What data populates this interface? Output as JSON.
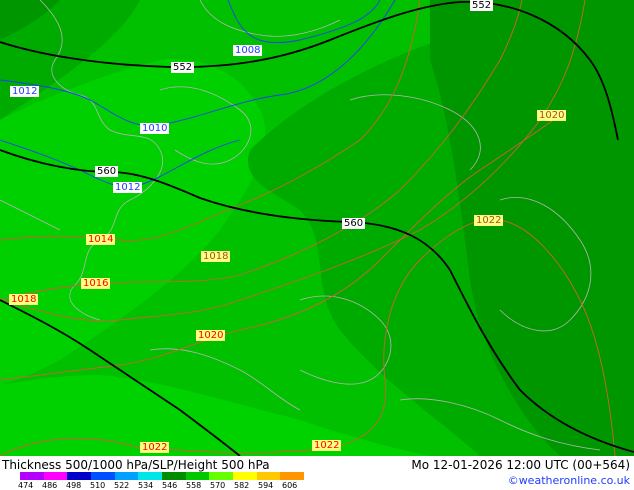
{
  "map": {
    "height_labels": [
      "552",
      "552",
      "560",
      "560"
    ],
    "slp_labels": [
      "1008",
      "1012",
      "1010",
      "1012",
      "1014",
      "1016",
      "1018",
      "1018",
      "1020",
      "1020",
      "1022",
      "1022",
      "1022"
    ]
  },
  "footer": {
    "title": "Thickness 500/1000 hPa/SLP/Height 500 hPa",
    "datetime": "Mo 12-01-2026 12:00 UTC (00+564)",
    "credit": "©weatheronline.co.uk",
    "scale_ticks": [
      "474",
      "486",
      "498",
      "510",
      "522",
      "534",
      "546",
      "558",
      "570",
      "582",
      "594",
      "606"
    ],
    "scale_colors": [
      "#b400ff",
      "#ff00ff",
      "#0000c8",
      "#0050ff",
      "#00a0ff",
      "#00e6e6",
      "#008c00",
      "#00c800",
      "#64ff00",
      "#ffff00",
      "#ffc800",
      "#ff9600"
    ]
  }
}
